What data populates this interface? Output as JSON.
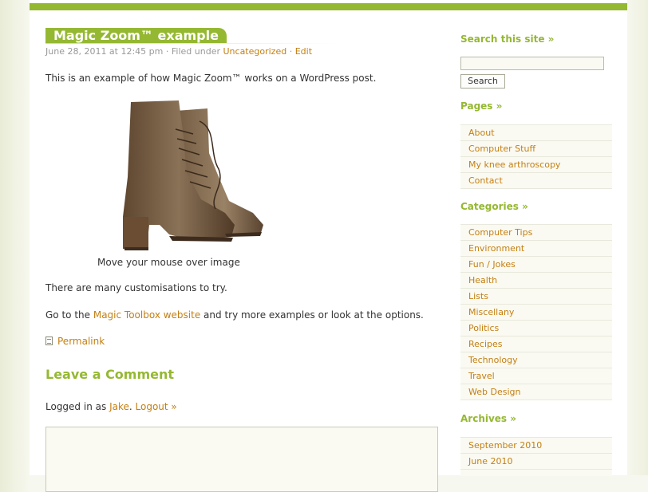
{
  "colors": {
    "accent": "#95b832",
    "link": "#c47f12",
    "text": "#333333"
  },
  "post": {
    "title": "Magic Zoom™ example",
    "date": "June 28, 2011 at 12:45 pm",
    "filed_under": "· Filed under",
    "category": "Uncategorized",
    "sep": "·",
    "edit": "Edit",
    "intro": "This is an example of how Magic Zoom™ works on a WordPress post.",
    "caption": "Move your mouse over image",
    "customisations": "There are many customisations to try.",
    "go_prefix": "Go to the",
    "toolbox_link": "Magic Toolbox website",
    "go_suffix": "and try more examples or look at the options.",
    "permalink": "Permalink",
    "image_icon": "boot-image"
  },
  "comments": {
    "heading": "Leave a Comment",
    "logged_prefix": "Logged in as",
    "user": "Jake",
    "dot": ".",
    "logout": "Logout »"
  },
  "sidebar": {
    "search_heading": "Search this site »",
    "search_button": "Search",
    "search_value": "",
    "pages_heading": "Pages »",
    "pages": [
      "About",
      "Computer Stuff",
      "My knee arthroscopy",
      "Contact"
    ],
    "categories_heading": "Categories »",
    "categories": [
      "Computer Tips",
      "Environment",
      "Fun / Jokes",
      "Health",
      "Lists",
      "Miscellany",
      "Politics",
      "Recipes",
      "Technology",
      "Travel",
      "Web Design"
    ],
    "archives_heading": "Archives »",
    "archives": [
      "September 2010",
      "June 2010"
    ]
  }
}
